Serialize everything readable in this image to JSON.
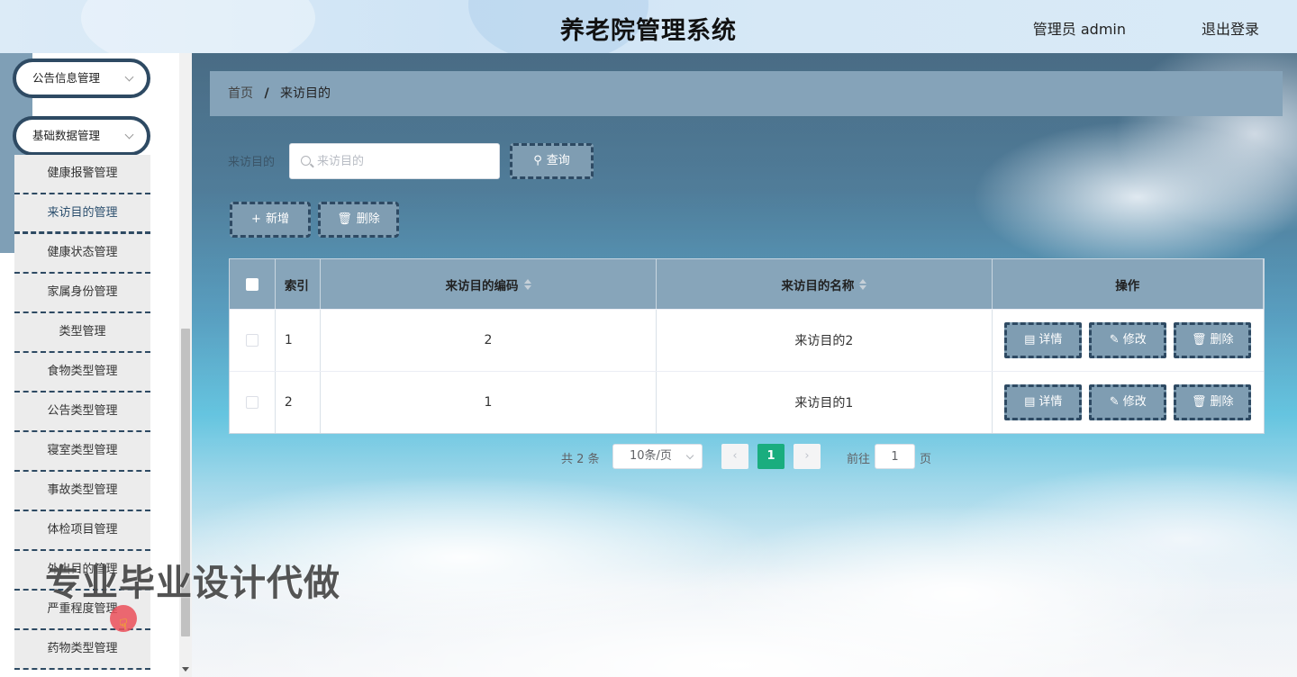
{
  "header": {
    "title": "养老院管理系统",
    "user_label": "管理员 admin",
    "logout_label": "退出登录"
  },
  "sidebar": {
    "menus": [
      {
        "label": "公告信息管理"
      },
      {
        "label": "基础数据管理"
      }
    ],
    "items": [
      {
        "label": "健康报警管理"
      },
      {
        "label": "来访目的管理"
      },
      {
        "label": "健康状态管理"
      },
      {
        "label": "家属身份管理"
      },
      {
        "label": "类型管理"
      },
      {
        "label": "食物类型管理"
      },
      {
        "label": "公告类型管理"
      },
      {
        "label": "寝室类型管理"
      },
      {
        "label": "事故类型管理"
      },
      {
        "label": "体检项目管理"
      },
      {
        "label": "外出目的管理"
      },
      {
        "label": "严重程度管理"
      },
      {
        "label": "药物类型管理"
      }
    ],
    "active_item": "来访目的管理"
  },
  "breadcrumb": {
    "home": "首页",
    "separator": "/",
    "current": "来访目的"
  },
  "search": {
    "label": "来访目的",
    "placeholder": "来访目的",
    "value": "",
    "query_label": "查询"
  },
  "toolbar": {
    "add_label": "新增",
    "delete_label": "删除"
  },
  "table": {
    "columns": [
      "索引",
      "来访目的编码",
      "来访目的名称",
      "操作"
    ],
    "rows": [
      {
        "index": "1",
        "code": "2",
        "name": "来访目的2"
      },
      {
        "index": "2",
        "code": "1",
        "name": "来访目的1"
      }
    ],
    "actions": {
      "detail": "详情",
      "edit": "修改",
      "delete": "删除"
    }
  },
  "pagination": {
    "total_text": "共 2 条",
    "page_size": "10条/页",
    "current_page": "1",
    "goto_label": "前往",
    "goto_value": "1",
    "page_suffix": "页"
  },
  "watermark": "专业毕业设计代做",
  "colors": {
    "accent": "#7f9db2",
    "dark_border": "#2e4a63",
    "active_page": "#1aad7e",
    "table_header": "#87a5ba"
  },
  "icons": {
    "search": "search-icon",
    "add": "plus-icon",
    "delete": "trash-icon",
    "detail": "document-icon",
    "edit": "pencil-icon",
    "dropdown": "chevron-down-icon"
  }
}
